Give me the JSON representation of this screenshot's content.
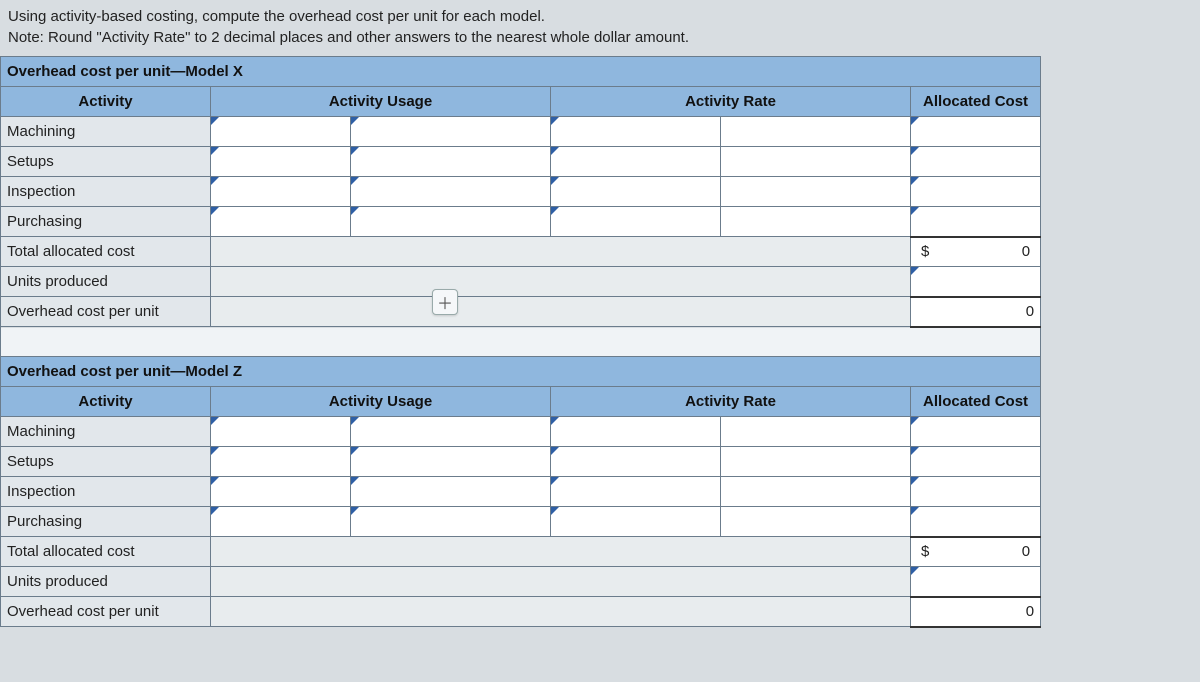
{
  "instructions": {
    "line1": "Using activity-based costing, compute the overhead cost per unit for each model.",
    "line2": "Note: Round \"Activity Rate\" to 2 decimal places and other answers to the nearest whole dollar amount."
  },
  "headers": {
    "activity": "Activity",
    "usage": "Activity Usage",
    "rate": "Activity Rate",
    "cost": "Allocated Cost"
  },
  "labels": {
    "machining": "Machining",
    "setups": "Setups",
    "inspection": "Inspection",
    "purchasing": "Purchasing",
    "total": "Total allocated cost",
    "units": "Units produced",
    "ohperunit": "Overhead cost per unit"
  },
  "sections": {
    "modelX": {
      "title": "Overhead cost per unit—Model X",
      "total_display": "0",
      "ohpu_display": "0",
      "currency": "$"
    },
    "modelZ": {
      "title": "Overhead cost per unit—Model Z",
      "total_display": "0",
      "ohpu_display": "0",
      "currency": "$"
    }
  },
  "icons": {
    "plus": "＋"
  }
}
